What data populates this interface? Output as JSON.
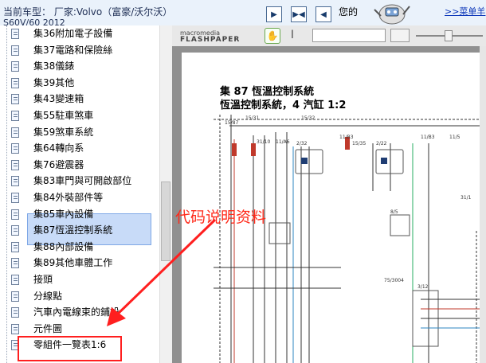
{
  "topbar": {
    "model_label": "当前车型： 厂家:Volvo（富豪/沃尔沃）",
    "model_sub": "S60V/60 2012",
    "hello": "您的",
    "menu_link": ">>菜单羊",
    "nav_icons": [
      "first-page-icon",
      "fit-page-icon",
      "prev-page-icon"
    ]
  },
  "tree": {
    "items": [
      "集36附加電子設備",
      "集37電路和保險絲",
      "集38儀錶",
      "集39其他",
      "集43變速箱",
      "集55駐車煞車",
      "集59煞車系統",
      "集64轉向系",
      "集76避震器",
      "集83車門與可開啟部位",
      "集84外裝部件等",
      "集85車內設備",
      "集87恆溫控制系統",
      "集88內部設備",
      "集89其他車體工作",
      "接頭",
      "分線點",
      "汽車內電線束的鋪設",
      "元件圖",
      "零組件一覽表1:6"
    ],
    "selected_index": 12
  },
  "flashpaper": {
    "logo_a": "macromedia",
    "logo_b": "FLASHPAPER",
    "search_placeholder": ""
  },
  "document": {
    "title1": "集 87 恆溫控制系統",
    "title2": "恆溫控制系統，4 汽缸 1:2",
    "watermark": "代码说明资料",
    "labels": [
      "15/87",
      "15/31",
      "15/32",
      "31/10",
      "11/A6",
      "11/B3",
      "2/32",
      "2/22",
      "15/35",
      "11/B3",
      "11/5",
      "8/5",
      "75/3004",
      "31/1",
      "3/12"
    ]
  },
  "colors": {
    "selection_bg": "#c8dbf8",
    "highlight_red": "#ff1f1f",
    "link_blue": "#0a35b8"
  }
}
